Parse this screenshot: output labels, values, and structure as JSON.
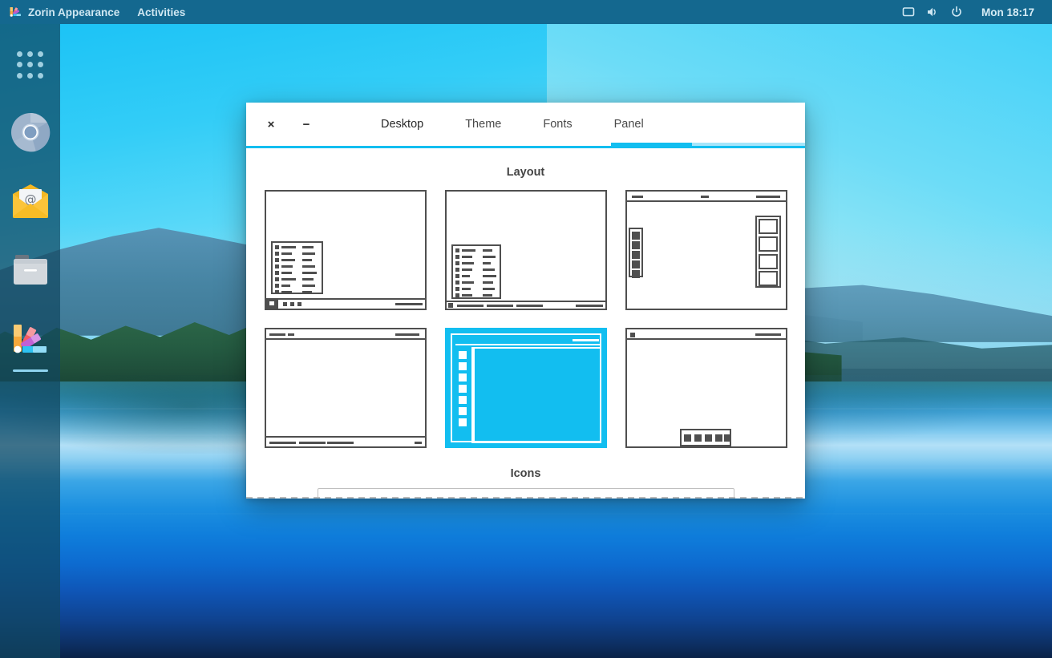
{
  "topbar": {
    "app_icon": "zorin-appearance-icon",
    "app_name": "Zorin Appearance",
    "activities_label": "Activities",
    "tray": [
      {
        "name": "display-icon",
        "glyph": "▭"
      },
      {
        "name": "volume-icon",
        "glyph": "◀"
      },
      {
        "name": "power-icon",
        "glyph": "⏻"
      }
    ],
    "clock": "Mon 18:17",
    "background_color": "#14688f",
    "text_color": "#cfe7f2"
  },
  "dock": {
    "items": [
      {
        "name": "show-applications-icon",
        "label": "Show Applications",
        "active": false
      },
      {
        "name": "chromium-browser-icon",
        "label": "Chromium Web Browser",
        "active": false
      },
      {
        "name": "mail-client-icon",
        "label": "Mail",
        "active": false
      },
      {
        "name": "file-manager-icon",
        "label": "Files",
        "active": false
      },
      {
        "name": "zorin-appearance-icon",
        "label": "Zorin Appearance",
        "active": true
      }
    ]
  },
  "window": {
    "titlebar": {
      "close_label": "×",
      "minimize_label": "−"
    },
    "tabs": [
      {
        "label": "Desktop",
        "active": true
      },
      {
        "label": "Theme",
        "active": false
      },
      {
        "label": "Fonts",
        "active": false
      },
      {
        "label": "Panel",
        "active": false
      }
    ],
    "accent_color": "#12bef0",
    "accent_light_color": "#a5e5fa",
    "sections": {
      "layout_title": "Layout",
      "icons_title": "Icons"
    },
    "layouts": [
      {
        "name": "layout-windows-classic",
        "selected": false
      },
      {
        "name": "layout-windows-taskbar",
        "selected": false
      },
      {
        "name": "layout-gnome-dock-left",
        "selected": false
      },
      {
        "name": "layout-topbar-taskbar",
        "selected": false
      },
      {
        "name": "layout-zorin-touch",
        "selected": true
      },
      {
        "name": "layout-macos-dock-bottom",
        "selected": false
      }
    ]
  }
}
